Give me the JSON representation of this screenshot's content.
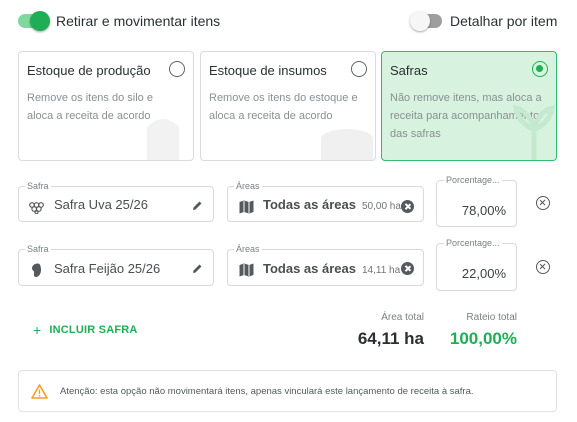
{
  "toggles": {
    "move_items": {
      "label": "Retirar e movimentar itens",
      "on": true
    },
    "detail_by_item": {
      "label": "Detalhar por item",
      "on": false
    }
  },
  "options": [
    {
      "title": "Estoque de produção",
      "description": "Remove os itens do silo e aloca a receita de acordo",
      "selected": false,
      "icon": "silo-icon"
    },
    {
      "title": "Estoque de insumos",
      "description": "Remove os itens do estoque e aloca a receita de acordo",
      "selected": false,
      "icon": "box-icon"
    },
    {
      "title": "Safras",
      "description": "Não remove itens, mas aloca a receita para acompanhamento das safras",
      "selected": true,
      "icon": "leaf-icon"
    }
  ],
  "rows": [
    {
      "safra_label": "Safra",
      "safra_value": "Safra Uva 25/26",
      "safra_icon": "grape-icon",
      "areas_label": "Áreas",
      "areas_value": "Todas as áreas",
      "areas_size": "50,00 ha",
      "pct_label": "Porcentage...",
      "pct_value": "78,00%"
    },
    {
      "safra_label": "Safra",
      "safra_value": "Safra Feijão 25/26",
      "safra_icon": "bean-icon",
      "areas_label": "Áreas",
      "areas_value": "Todas as áreas",
      "areas_size": "14,11 ha",
      "pct_label": "Porcentage...",
      "pct_value": "22,00%"
    }
  ],
  "add_button": {
    "icon": "+",
    "label": "INCLUIR SAFRA"
  },
  "totals": {
    "area_label": "Área total",
    "area_value": "64,11 ha",
    "rateio_label": "Rateio total",
    "rateio_value": "100,00%"
  },
  "warning": {
    "icon": "warning-icon",
    "text": "Atenção: esta opção não movimentará itens, apenas vinculará este lançamento de receita à safra."
  },
  "colors": {
    "accent": "#1fae55",
    "selected_card_bg": "#d7f3df",
    "warning_icon": "#f0a020"
  }
}
